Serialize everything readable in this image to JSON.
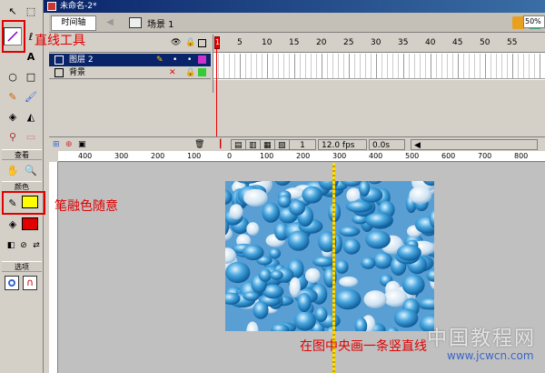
{
  "window": {
    "title": "未命名-2*"
  },
  "timeline": {
    "tab_label": "时间轴",
    "scene_label": "场景 1",
    "layers": [
      {
        "name": "图层 2",
        "selected": true,
        "color": "#cc33cc"
      },
      {
        "name": "背景",
        "selected": false,
        "color": "#33cc33"
      }
    ],
    "frame_numbers": [
      "1",
      "5",
      "10",
      "15",
      "20",
      "25",
      "30",
      "35",
      "40",
      "45",
      "50",
      "55"
    ],
    "footer": {
      "current_frame": "1",
      "frame_rate": "12.0 fps",
      "time": "0.0s"
    }
  },
  "toolbox": {
    "section_view": "查看",
    "section_colors": "颜色",
    "section_options": "选项",
    "stroke_color": "#000000",
    "fill_color": "#ffff00",
    "fill_color_2": "#e00000"
  },
  "stage": {
    "zoom": "50%",
    "ruler_numbers": [
      "400",
      "300",
      "200",
      "100",
      "0",
      "100",
      "200",
      "300",
      "400",
      "500",
      "600",
      "700",
      "800"
    ]
  },
  "annotations": {
    "line_tool": "直线工具",
    "stroke_color_note": "笔融色随意",
    "draw_line_note": "在图中央画一条竖直线"
  },
  "watermark": {
    "text": "中国教程网",
    "url": "www.jcwcn.com"
  }
}
